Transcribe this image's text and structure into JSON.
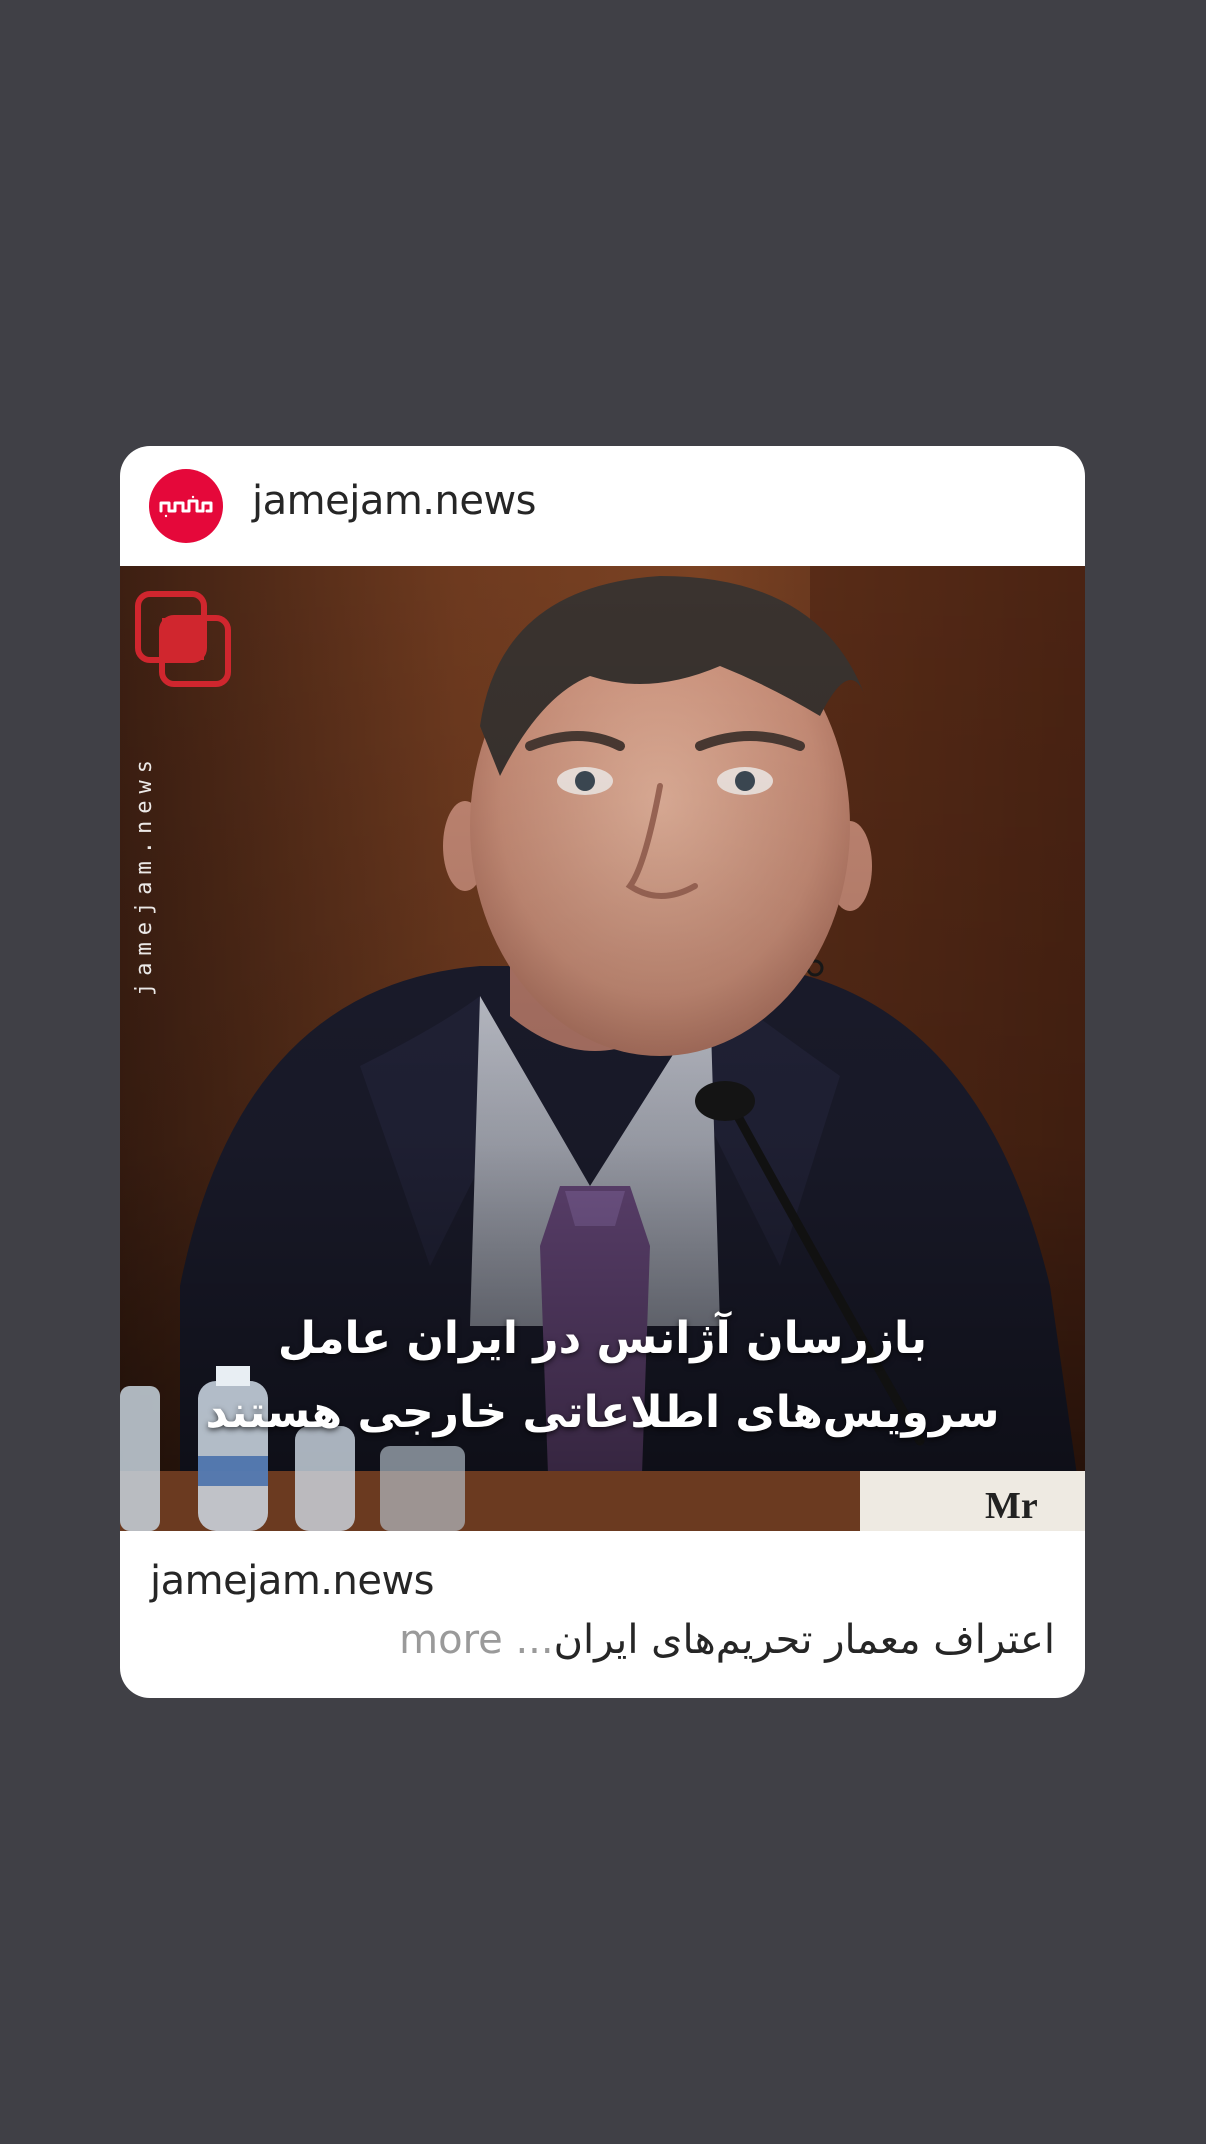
{
  "post": {
    "header": {
      "handle": "jamejam.news",
      "avatar_icon": "jamejam-logo-icon",
      "avatar_color": "#e5083a"
    },
    "media": {
      "watermark_logo_icon": "jamejam-overlapping-squares-logo",
      "watermark_text": "jamejam.news",
      "headline": "بازرسان آژانس در ایران عامل سرویس‌های اطلاعاتی خارجی هستند",
      "accent_rule_color": "#d0262e"
    },
    "footer": {
      "handle": "jamejam.news",
      "caption": "اعتراف معمار تحریم‌های ایران",
      "ellipsis": "...",
      "more_label": "more"
    }
  },
  "colors": {
    "background": "#404046",
    "card": "#ffffff",
    "text_primary": "#262626",
    "text_muted": "#9a9a9a"
  }
}
